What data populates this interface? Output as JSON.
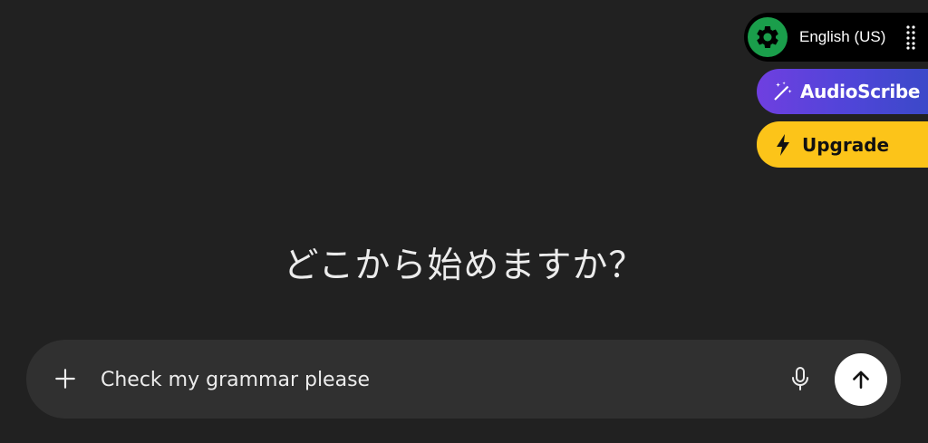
{
  "extension": {
    "language_label": "English (US)",
    "audioscribe_label": "AudioScribe",
    "upgrade_label": "Upgrade",
    "icons": {
      "settings": "gear-icon",
      "drag": "drag-handle-icon",
      "audioscribe": "magic-wand-icon",
      "upgrade": "lightning-bolt-icon"
    },
    "colors": {
      "gear_bg": "#1a9e4b",
      "audioscribe_start": "#6f3fe0",
      "audioscribe_end": "#3b49c9",
      "upgrade_bg": "#fcc419"
    }
  },
  "main": {
    "heading": "どこから始めますか？"
  },
  "composer": {
    "input_value": "Check my grammar please",
    "icons": {
      "attach": "plus-icon",
      "voice": "microphone-icon",
      "send": "arrow-up-icon"
    }
  }
}
